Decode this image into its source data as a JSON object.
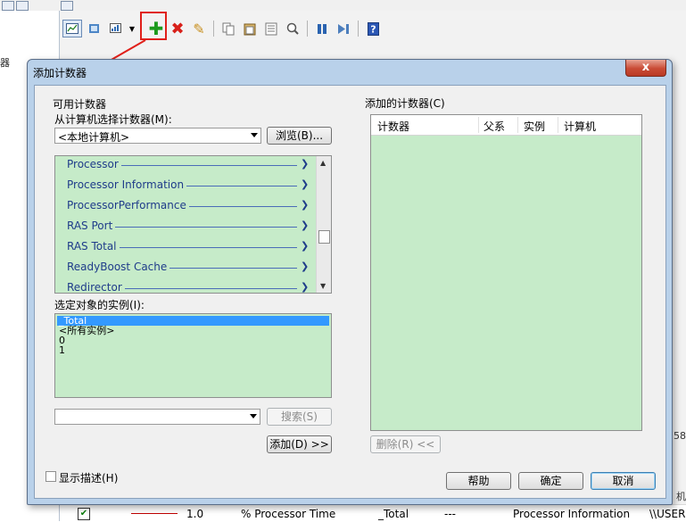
{
  "background": {
    "left_fragment": "器",
    "bottom_row": {
      "scale": "1.0",
      "counter": "% Processor Time",
      "instance": "_Total",
      "parent": "---",
      "object": "Processor Information",
      "computer": "\\\\USER"
    },
    "right_edge": {
      "e1": "58:",
      "e2": "机"
    }
  },
  "dialog": {
    "title": "添加计数器",
    "close_label": "x",
    "available_group": "可用计数器",
    "select_from_label": "从计算机选择计数器(M):",
    "computer_value": "<本地计算机>",
    "browse_label": "浏览(B)...",
    "objects": [
      "Processor",
      "Processor Information",
      "ProcessorPerformance",
      "RAS Port",
      "RAS Total",
      "ReadyBoost Cache",
      "Redirector"
    ],
    "instances_label": "选定对象的实例(I):",
    "instances": [
      "_Total",
      "<所有实例>",
      "0",
      "1"
    ],
    "search_label": "搜索(S)",
    "add_label": "添加(D) >>",
    "added_group": "添加的计数器(C)",
    "columns": [
      "计数器",
      "父系",
      "实例",
      "计算机"
    ],
    "remove_label": "删除(R) <<",
    "show_desc_label": "显示描述(H)",
    "help_label": "帮助",
    "ok_label": "确定",
    "cancel_label": "取消"
  }
}
